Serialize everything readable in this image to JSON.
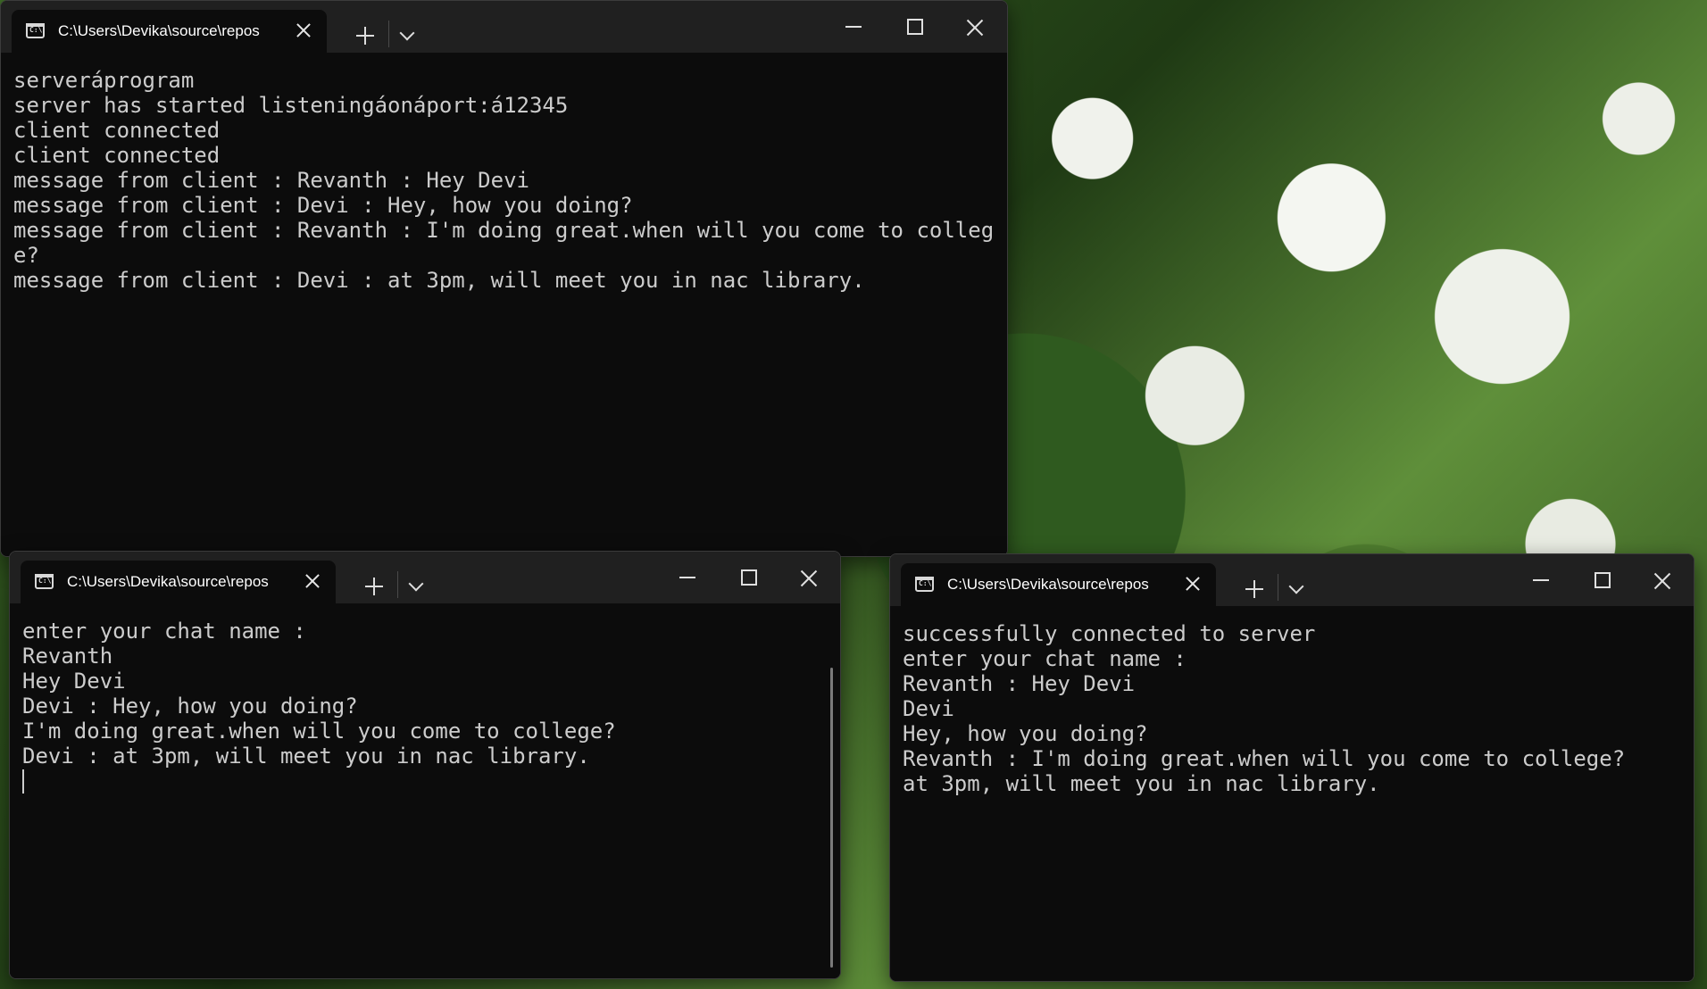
{
  "windows": [
    {
      "tab_title": "C:\\Users\\Devika\\source\\repos",
      "lines": [
        "serveráprogram",
        "server has started listeningáonáport:á12345",
        "client connected",
        "client connected",
        "message from client : Revanth : Hey Devi",
        "message from client : Devi : Hey, how you doing?",
        "message from client : Revanth : I'm doing great.when will you come to colleg\ne?",
        "message from client : Devi : at 3pm, will meet you in nac library."
      ]
    },
    {
      "tab_title": "C:\\Users\\Devika\\source\\repos",
      "lines": [
        "enter your chat name :",
        "Revanth",
        "Hey Devi",
        "Devi : Hey, how you doing?",
        "I'm doing great.when will you come to college?",
        "Devi : at 3pm, will meet you in nac library."
      ]
    },
    {
      "tab_title": "C:\\Users\\Devika\\source\\repos",
      "lines": [
        "successfully connected to server",
        "enter your chat name :",
        "Revanth : Hey Devi",
        "Devi",
        "Hey, how you doing?",
        "Revanth : I'm doing great.when will you come to college?",
        "at 3pm, will meet you in nac library."
      ]
    }
  ],
  "icons": {
    "tab_icon": "terminal-icon",
    "tab_icon_text": "C:\\",
    "close_tab": "close-icon",
    "new_tab": "plus-icon",
    "dropdown": "chevron-down-icon",
    "minimize": "minimize-icon",
    "maximize": "maximize-icon",
    "close_window": "close-icon"
  },
  "colors": {
    "terminal_bg": "#0c0c0c",
    "titlebar_bg": "#202020",
    "text": "#cccccc"
  }
}
